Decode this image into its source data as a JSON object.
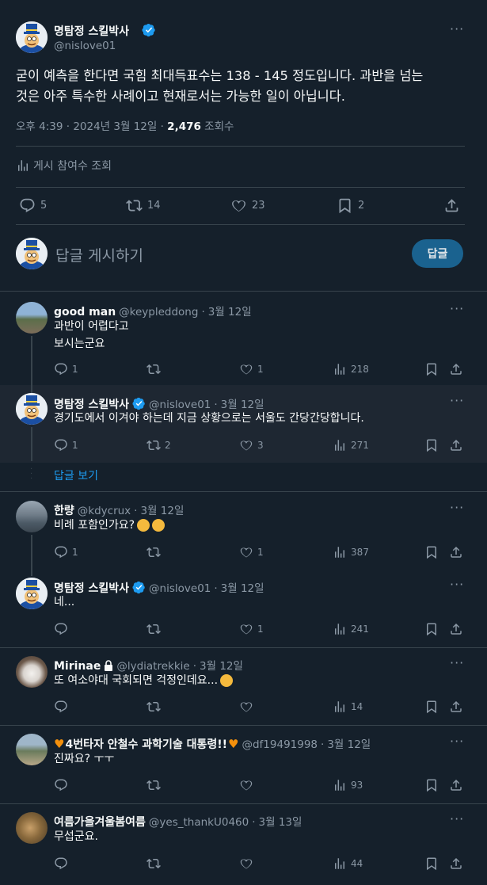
{
  "main_tweet": {
    "author_name": "명탐정 스킬박사",
    "handle": "@nislove01",
    "text_line1": "굳이 예측을 한다면 국힘 최대득표수는 138 -  145 정도입니다.  과반을 넘는",
    "text_line2": "것은 아주 특수한 사례이고 현재로서는 가능한 일이 아닙니다.",
    "time": "오후 4:39 · 2024년 3월 12일 · ",
    "views_count": "2,476",
    "views_label": " 조회수",
    "engagement_label": "게시 참여수 조회",
    "stats": {
      "replies": "5",
      "retweets": "14",
      "likes": "23",
      "bookmarks": "2"
    }
  },
  "compose": {
    "placeholder": "답글 게시하기",
    "button_label": "답글"
  },
  "show_replies_label": "답글 보기",
  "replies": [
    {
      "name": "good man",
      "handle": "@keypleddong",
      "date": "3월 12일",
      "lines": [
        "과반이 어렵다고",
        "보시는군요"
      ],
      "replies": "1",
      "retweets": "",
      "likes": "1",
      "views": "218"
    },
    {
      "name": "명탐정 스킬박사",
      "handle": "@nislove01",
      "date": "3월 12일",
      "lines": [
        "경기도에서 이겨야 하는데 지금 상황으로는 서울도 간당간당합니다."
      ],
      "replies": "1",
      "retweets": "2",
      "likes": "3",
      "views": "271"
    },
    {
      "name": "한량",
      "handle": "@kdycrux",
      "date": "3월 12일",
      "lines": [
        "비례 포함인가요?"
      ],
      "replies": "1",
      "retweets": "",
      "likes": "1",
      "views": "387"
    },
    {
      "name": "명탐정 스킬박사",
      "handle": "@nislove01",
      "date": "3월 12일",
      "lines": [
        "네..."
      ],
      "replies": "",
      "retweets": "",
      "likes": "1",
      "views": "241"
    },
    {
      "name": "Mirinae",
      "handle": "@lydiatrekkie",
      "date": "3월 12일",
      "lines": [
        "또 여소야대 국회되면 걱정인데요..."
      ],
      "replies": "",
      "retweets": "",
      "likes": "",
      "views": "14"
    },
    {
      "name": "4번타자 안철수 과학기술 대통령!!",
      "handle": "@df19491998",
      "date": "3월 12일",
      "lines": [
        "진짜요? ㅜㅜ"
      ],
      "replies": "",
      "retweets": "",
      "likes": "",
      "views": "93"
    },
    {
      "name": "여름가을겨울봄여름",
      "handle": "@yes_thankU0460",
      "date": "3월 13일",
      "lines": [
        "무섭군요."
      ],
      "replies": "",
      "retweets": "",
      "likes": "",
      "views": "44"
    }
  ],
  "colors": {
    "background": "#15202b",
    "accent": "#1d9bf0",
    "muted": "#8b98a5",
    "divider": "#38444d"
  }
}
